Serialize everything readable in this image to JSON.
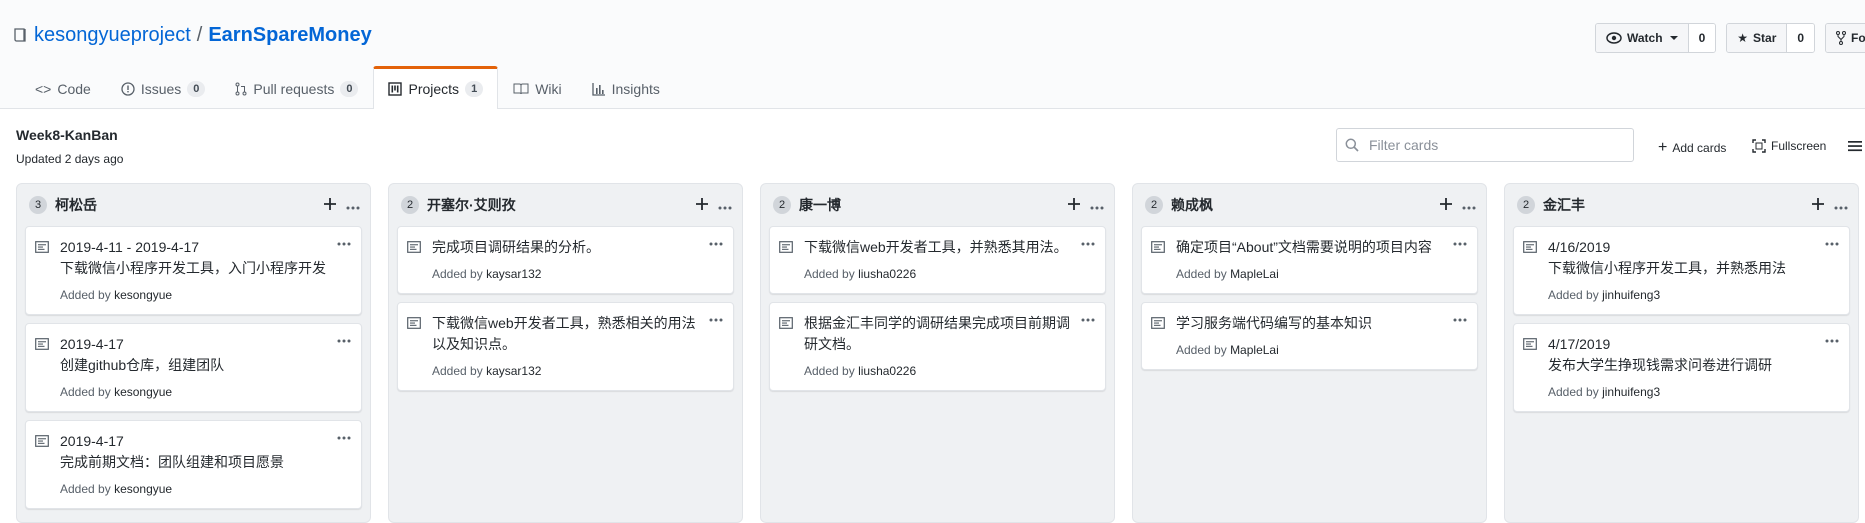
{
  "repo": {
    "owner": "kesongyueproject",
    "separator": "/",
    "name": "EarnSpareMoney"
  },
  "actions": {
    "watch": {
      "label": "Watch",
      "count": "0"
    },
    "star": {
      "label": "Star",
      "count": "0"
    },
    "fork": {
      "label": "Fork"
    }
  },
  "tabs": [
    {
      "label": "Code",
      "icon": "code-icon"
    },
    {
      "label": "Issues",
      "count": "0",
      "icon": "issue-icon"
    },
    {
      "label": "Pull requests",
      "count": "0",
      "icon": "pull-request-icon"
    },
    {
      "label": "Projects",
      "count": "1",
      "icon": "project-icon",
      "active": true
    },
    {
      "label": "Wiki",
      "icon": "book-icon"
    },
    {
      "label": "Insights",
      "icon": "graph-icon"
    }
  ],
  "project": {
    "name": "Week8-KanBan",
    "updated": "Updated 2 days ago",
    "filter_placeholder": "Filter cards",
    "add_cards": "Add cards",
    "fullscreen": "Fullscreen"
  },
  "card_added_prefix": "Added by",
  "columns": [
    {
      "count": "3",
      "title": "柯松岳",
      "cards": [
        {
          "lines": [
            "2019-4-11 - 2019-4-17",
            "下载微信小程序开发工具，入门小程序开发"
          ],
          "author": "kesongyue"
        },
        {
          "lines": [
            "2019-4-17",
            "创建github仓库，组建团队"
          ],
          "author": "kesongyue"
        },
        {
          "lines": [
            "2019-4-17",
            "完成前期文档：团队组建和项目愿景"
          ],
          "author": "kesongyue"
        }
      ]
    },
    {
      "count": "2",
      "title": "开塞尔·艾则孜",
      "cards": [
        {
          "lines": [
            "完成项目调研结果的分析。"
          ],
          "author": "kaysar132"
        },
        {
          "lines": [
            "下载微信web开发者工具，熟悉相关的用法",
            "以及知识点。"
          ],
          "author": "kaysar132"
        }
      ]
    },
    {
      "count": "2",
      "title": "康一博",
      "cards": [
        {
          "lines": [
            "下载微信web开发者工具，并熟悉其用法。"
          ],
          "author": "liusha0226"
        },
        {
          "lines": [
            "根据金汇丰同学的调研结果完成项目前期调",
            "研文档。"
          ],
          "author": "liusha0226"
        }
      ]
    },
    {
      "count": "2",
      "title": "赖成枫",
      "cards": [
        {
          "lines": [
            "确定项目“About”文档需要说明的项目内容"
          ],
          "author": "MapleLai"
        },
        {
          "lines": [
            "学习服务端代码编写的基本知识"
          ],
          "author": "MapleLai"
        }
      ]
    },
    {
      "count": "2",
      "title": "金汇丰",
      "cards": [
        {
          "lines": [
            "4/16/2019",
            "下载微信小程序开发工具，并熟悉用法"
          ],
          "author": "jinhuifeng3"
        },
        {
          "lines": [
            "4/17/2019",
            "发布大学生挣现钱需求问卷进行调研"
          ],
          "author": "jinhuifeng3"
        }
      ]
    }
  ]
}
